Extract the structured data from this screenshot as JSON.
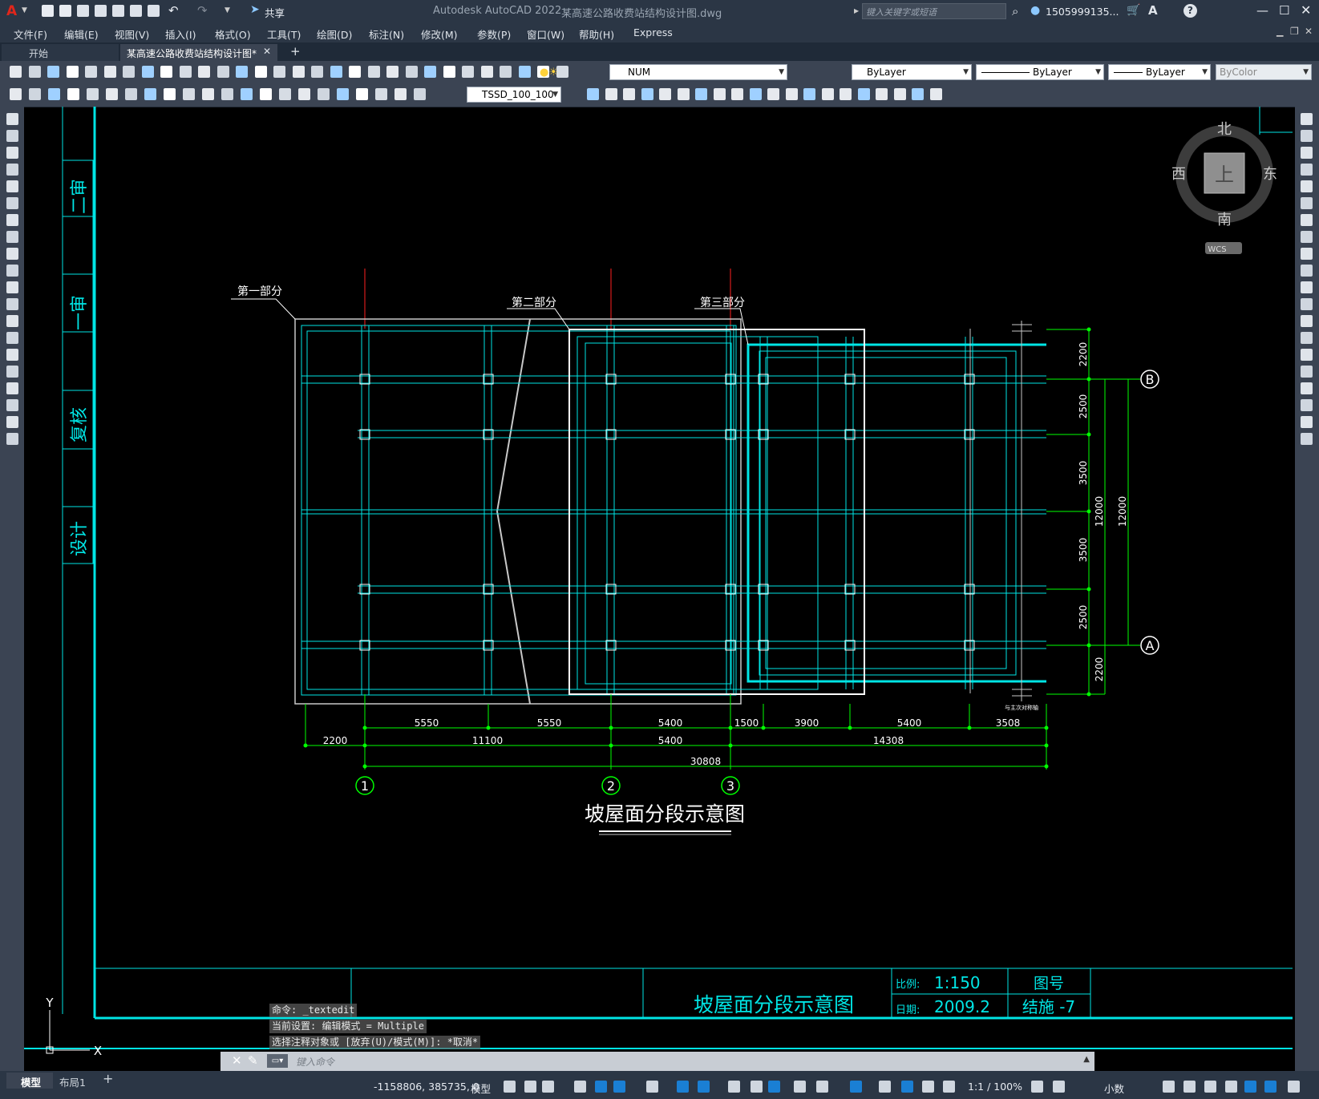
{
  "app": {
    "logo": "A",
    "title": "Autodesk AutoCAD 2022",
    "file": "某高速公路收费站结构设计图.dwg",
    "search_placeholder": "键入关键字或短语",
    "user": "1505999135...",
    "share": "共享"
  },
  "menu": [
    "文件(F)",
    "编辑(E)",
    "视图(V)",
    "插入(I)",
    "格式(O)",
    "工具(T)",
    "绘图(D)",
    "标注(N)",
    "修改(M)",
    "参数(P)",
    "窗口(W)",
    "帮助(H)",
    "Express"
  ],
  "tabs": {
    "start": "开始",
    "doc": "某高速公路收费站结构设计图*"
  },
  "toolbar": {
    "layer_state": "NUM",
    "color": "ByLayer",
    "linetype": "ByLayer",
    "lineweight": "ByLayer",
    "plotstyle": "ByColor",
    "dimstyle": "TSSD_100_100"
  },
  "viewcube": {
    "north": "北",
    "south": "南",
    "west": "西",
    "east": "东",
    "face": "上",
    "wcs": "WCS"
  },
  "drawing": {
    "part_labels": [
      "第一部分",
      "第二部分",
      "第三部分"
    ],
    "row_dims": [
      "2200",
      "2500",
      "3500",
      "3500",
      "2500",
      "2200"
    ],
    "total_dims": [
      "12000",
      "12000"
    ],
    "axes_right": [
      "B",
      "A"
    ],
    "dims_row1": [
      "5550",
      "5550",
      "5400",
      "1500",
      "3900",
      "5400",
      "3508"
    ],
    "dims_row2": [
      "2200",
      "11100",
      "5400",
      "14308"
    ],
    "dim_total": "30808",
    "axes_bottom": [
      "1",
      "2",
      "3"
    ],
    "title": "坡屋面分段示意图",
    "small_note": "与主次对称轴"
  },
  "side_block": [
    "二审",
    "一审",
    "复核",
    "设计"
  ],
  "title_block": {
    "name": "坡屋面分段示意图",
    "scale_label": "比例:",
    "scale": "1:150",
    "date_label": "日期:",
    "date": "2009.2",
    "drawing_no_label": "图号",
    "drawing_no": "结施 -7"
  },
  "command": {
    "history": [
      "命令: _textedit",
      "当前设置: 编辑模式 = Multiple",
      "选择注释对象或 [放弃(U)/模式(M)]: *取消*"
    ],
    "placeholder": "键入命令"
  },
  "ucs": {
    "x": "X",
    "y": "Y"
  },
  "layout_tabs": [
    "模型",
    "布局1"
  ],
  "status": {
    "coords": "-1158806, 385735, 0",
    "model": "模型",
    "scale": "1:1 / 100%",
    "units": "小数"
  },
  "colors": {
    "cyan": "#00e5e5",
    "green": "#00ff00",
    "red": "#ff2020",
    "white": "#ffffff",
    "chrome": "#2b3645",
    "toolbar": "#3b4453",
    "accent": "#1a7fd4"
  }
}
